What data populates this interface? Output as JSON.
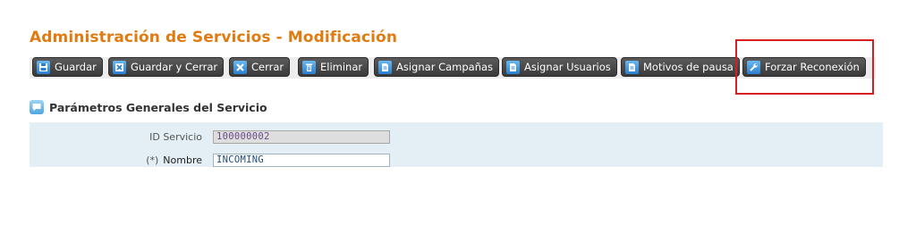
{
  "page": {
    "title": "Administración de Servicios - Modificación"
  },
  "toolbar": {
    "buttons": [
      {
        "label": "Guardar",
        "icon": "save-icon"
      },
      {
        "label": "Guardar y Cerrar",
        "icon": "save-close-icon"
      },
      {
        "label": "Cerrar",
        "icon": "close-icon"
      },
      {
        "label": "Eliminar",
        "icon": "trash-icon"
      },
      {
        "label": "Asignar Campañas",
        "icon": "document-icon"
      },
      {
        "label": "Asignar Usuarios",
        "icon": "document-icon"
      },
      {
        "label": "Motivos de pausa",
        "icon": "document-icon"
      },
      {
        "label": "Forzar Reconexión",
        "icon": "wrench-icon"
      }
    ]
  },
  "section": {
    "title": "Parámetros Generales del Servicio"
  },
  "form": {
    "id_servicio": {
      "label": "ID Servicio",
      "value": "100000002"
    },
    "nombre": {
      "required_marker": "(*)",
      "label": "Nombre",
      "value": "INCOMING"
    }
  },
  "colors": {
    "title": "#e07b12",
    "highlight": "#d42020",
    "panel": "#e3eff4"
  }
}
